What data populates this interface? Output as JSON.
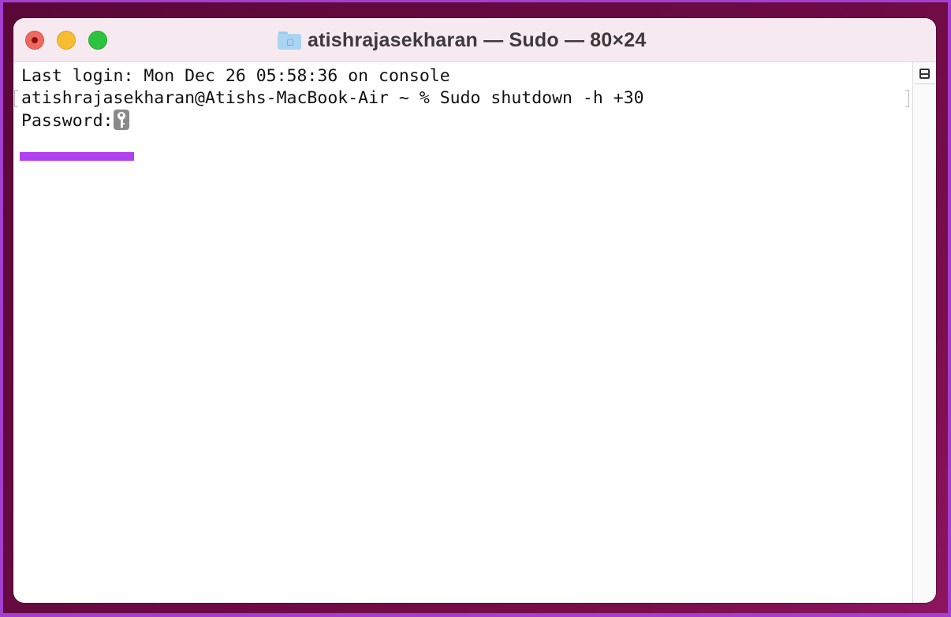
{
  "window": {
    "title": "atishrajasekharan — Sudo — 80×24",
    "title_icon": "folder-icon",
    "traffic_lights": [
      "close",
      "minimize",
      "zoom"
    ]
  },
  "terminal": {
    "lines": [
      "Last login: Mon Dec 26 05:58:36 on console",
      "atishrajasekharan@Atishs-MacBook-Air ~ % Sudo shutdown -h +30",
      "Password:"
    ],
    "password_indicator": "key-icon",
    "highlight_color": "#b042f0"
  },
  "scrollbar": {
    "split_button": "split-pane-icon"
  },
  "colors": {
    "frame_border": "#a23fd0",
    "desktop": "#5a0838",
    "titlebar": "#f6e9ef",
    "close": "#ee6a5e",
    "minimize": "#f5bd2f",
    "zoom": "#2ec33f"
  }
}
